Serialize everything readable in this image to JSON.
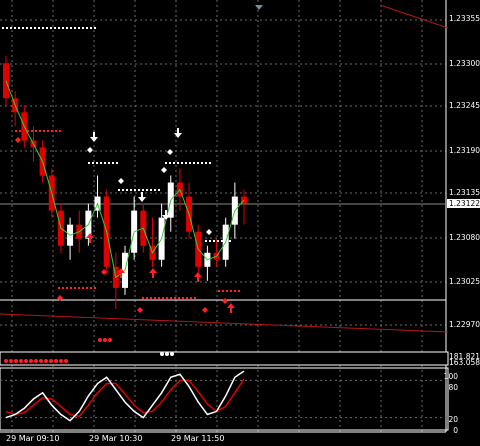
{
  "colors": {
    "background": "#000000",
    "grid": "#6b6b6b",
    "bull_candle": "#ffffff",
    "bear_candle": "#e00000",
    "ma_line": "#33cc33",
    "trendline": "#b01818",
    "signal_marker": "#ff2020",
    "level_dots": "#ffffff",
    "current_price_bg": "#ffffff",
    "stoch_main": "#ffffff",
    "stoch_signal": "#e00000"
  },
  "price_axis": {
    "labels": [
      "1.23355",
      "1.23300",
      "1.23245",
      "1.23190",
      "1.23135",
      "1.23080",
      "1.23025",
      "1.22970"
    ],
    "current_price": "1.23122",
    "subwindow_values": [
      "181.82118",
      "163.0588"
    ]
  },
  "time_axis": {
    "labels": [
      "29 Mar 09:10",
      "29 Mar 10:30",
      "29 Mar 11:50"
    ]
  },
  "oscillator": {
    "name": "stochastic",
    "levels": [
      "100",
      "80",
      "20",
      "0"
    ]
  },
  "chart_data": {
    "type": "candlestick",
    "instrument_price_range": [
      1.2294,
      1.2339
    ],
    "candles": [
      {
        "o": 1.2332,
        "h": 1.2333,
        "l": 1.2326,
        "c": 1.2327
      },
      {
        "o": 1.2327,
        "h": 1.2328,
        "l": 1.2323,
        "c": 1.2325
      },
      {
        "o": 1.2325,
        "h": 1.2326,
        "l": 1.232,
        "c": 1.2321
      },
      {
        "o": 1.2321,
        "h": 1.2323,
        "l": 1.2318,
        "c": 1.232
      },
      {
        "o": 1.232,
        "h": 1.2321,
        "l": 1.2315,
        "c": 1.2316
      },
      {
        "o": 1.2316,
        "h": 1.2317,
        "l": 1.231,
        "c": 1.2311
      },
      {
        "o": 1.2311,
        "h": 1.2312,
        "l": 1.2305,
        "c": 1.2306
      },
      {
        "o": 1.2306,
        "h": 1.231,
        "l": 1.2304,
        "c": 1.2309
      },
      {
        "o": 1.2309,
        "h": 1.2311,
        "l": 1.2305,
        "c": 1.2307
      },
      {
        "o": 1.2307,
        "h": 1.2312,
        "l": 1.2306,
        "c": 1.2311
      },
      {
        "o": 1.2311,
        "h": 1.2316,
        "l": 1.231,
        "c": 1.2313
      },
      {
        "o": 1.2313,
        "h": 1.2314,
        "l": 1.2302,
        "c": 1.2303
      },
      {
        "o": 1.2303,
        "h": 1.2305,
        "l": 1.2297,
        "c": 1.23
      },
      {
        "o": 1.23,
        "h": 1.2306,
        "l": 1.2299,
        "c": 1.2305
      },
      {
        "o": 1.2305,
        "h": 1.2313,
        "l": 1.2304,
        "c": 1.2311
      },
      {
        "o": 1.2311,
        "h": 1.2312,
        "l": 1.2305,
        "c": 1.2306
      },
      {
        "o": 1.2306,
        "h": 1.231,
        "l": 1.2303,
        "c": 1.2304
      },
      {
        "o": 1.2304,
        "h": 1.2312,
        "l": 1.2303,
        "c": 1.231
      },
      {
        "o": 1.231,
        "h": 1.2316,
        "l": 1.2308,
        "c": 1.2315
      },
      {
        "o": 1.2315,
        "h": 1.2317,
        "l": 1.2311,
        "c": 1.2313
      },
      {
        "o": 1.2313,
        "h": 1.2315,
        "l": 1.2307,
        "c": 1.2308
      },
      {
        "o": 1.2308,
        "h": 1.2309,
        "l": 1.2302,
        "c": 1.2303
      },
      {
        "o": 1.2303,
        "h": 1.2306,
        "l": 1.2301,
        "c": 1.2305
      },
      {
        "o": 1.2305,
        "h": 1.2307,
        "l": 1.2303,
        "c": 1.2304
      },
      {
        "o": 1.2304,
        "h": 1.231,
        "l": 1.2303,
        "c": 1.2309
      },
      {
        "o": 1.2309,
        "h": 1.2315,
        "l": 1.2307,
        "c": 1.2313
      },
      {
        "o": 1.2313,
        "h": 1.2314,
        "l": 1.2309,
        "c": 1.2312
      }
    ],
    "stochastic_main": [
      20,
      25,
      35,
      50,
      60,
      40,
      25,
      15,
      30,
      55,
      75,
      85,
      65,
      45,
      30,
      20,
      40,
      60,
      85,
      90,
      70,
      45,
      25,
      30,
      55,
      85,
      95
    ],
    "stochastic_signal": [
      30,
      25,
      28,
      40,
      52,
      50,
      38,
      25,
      22,
      40,
      60,
      75,
      75,
      58,
      40,
      28,
      30,
      45,
      65,
      80,
      80,
      62,
      42,
      30,
      38,
      60,
      82
    ]
  }
}
